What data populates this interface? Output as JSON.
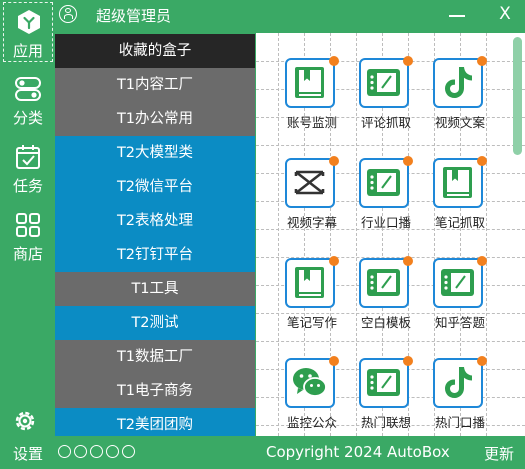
{
  "window": {
    "title": "超级管理员"
  },
  "nav": [
    {
      "label": "应用",
      "icon": "hexagon-app-icon"
    },
    {
      "label": "分类",
      "icon": "toggle-category-icon"
    },
    {
      "label": "任务",
      "icon": "calendar-check-icon"
    },
    {
      "label": "商店",
      "icon": "grid-store-icon"
    }
  ],
  "footer": {
    "settings_label": "设置",
    "copyright": "Copyright  2024   AutoBox",
    "update_label": "更新"
  },
  "categories": [
    {
      "label": "收藏的盒子"
    },
    {
      "label": "T1内容工厂"
    },
    {
      "label": "T1办公常用"
    },
    {
      "label": "T2大模型类"
    },
    {
      "label": "T2微信平台"
    },
    {
      "label": "T2表格处理"
    },
    {
      "label": "T2钉钉平台"
    },
    {
      "label": "T1工具"
    },
    {
      "label": "T2测试"
    },
    {
      "label": "T1数据工厂"
    },
    {
      "label": "T1电子商务"
    },
    {
      "label": "T2美团团购"
    }
  ],
  "tiles": [
    {
      "label": "账号监测",
      "icon": "book-icon"
    },
    {
      "label": "评论抓取",
      "icon": "tablet-icon"
    },
    {
      "label": "视频文案",
      "icon": "tiktok-icon"
    },
    {
      "label": "视频字幕",
      "icon": "capcut-icon"
    },
    {
      "label": "行业口播",
      "icon": "tablet-icon"
    },
    {
      "label": "笔记抓取",
      "icon": "book-icon"
    },
    {
      "label": "笔记写作",
      "icon": "book-icon"
    },
    {
      "label": "空白模板",
      "icon": "tablet-icon"
    },
    {
      "label": "知乎答题",
      "icon": "tablet-icon"
    },
    {
      "label": "监控公众",
      "icon": "wechat-icon"
    },
    {
      "label": "热门联想",
      "icon": "tablet-icon"
    },
    {
      "label": "热门口播",
      "icon": "tiktok-icon"
    }
  ],
  "colors": {
    "primary_green": "#3aa965",
    "tile_border": "#1e88d8",
    "badge": "#f2801e",
    "category_blue": "#0b8cc4",
    "category_gray": "#6b6b6b",
    "category_dark": "#262626"
  }
}
